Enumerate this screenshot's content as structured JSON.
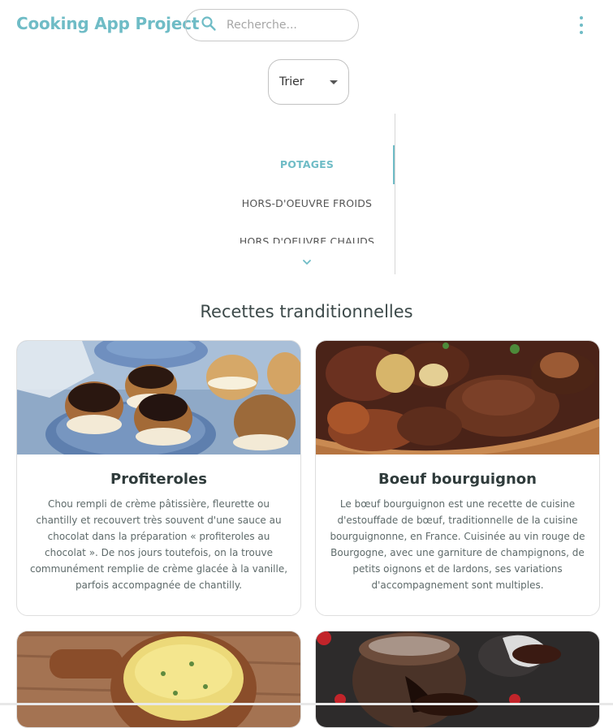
{
  "header": {
    "app_title": "Cooking App Project",
    "search_placeholder": "Recherche...",
    "accent_color": "#6fbcc6"
  },
  "sort": {
    "label": "Trier"
  },
  "categories": {
    "items": [
      "POTAGES",
      "HORS-D'OEUVRE FROIDS",
      "HORS D'OEUVRE CHAUDS"
    ],
    "active_index": 0
  },
  "section": {
    "title": "Recettes tranditionnelles"
  },
  "recipes": [
    {
      "title": "Profiteroles",
      "description": "Chou rempli de crème pâtissière, fleurette ou chantilly et recouvert très souvent d'une sauce au chocolat dans la préparation « profiteroles au chocolat ». De nos jours toutefois, on la trouve communément remplie de crème glacée à la vanille, parfois accompagnée de chantilly."
    },
    {
      "title": "Boeuf bourguignon",
      "description": "Le bœuf bourguignon est une recette de cuisine d'estouffade de bœuf, traditionnelle de la cuisine bourguignonne, en France. Cuisinée au vin rouge de Bourgogne, avec une garniture de champignons, de petits oignons et de lardons, ses variations d'accompagnement sont multiples."
    }
  ]
}
